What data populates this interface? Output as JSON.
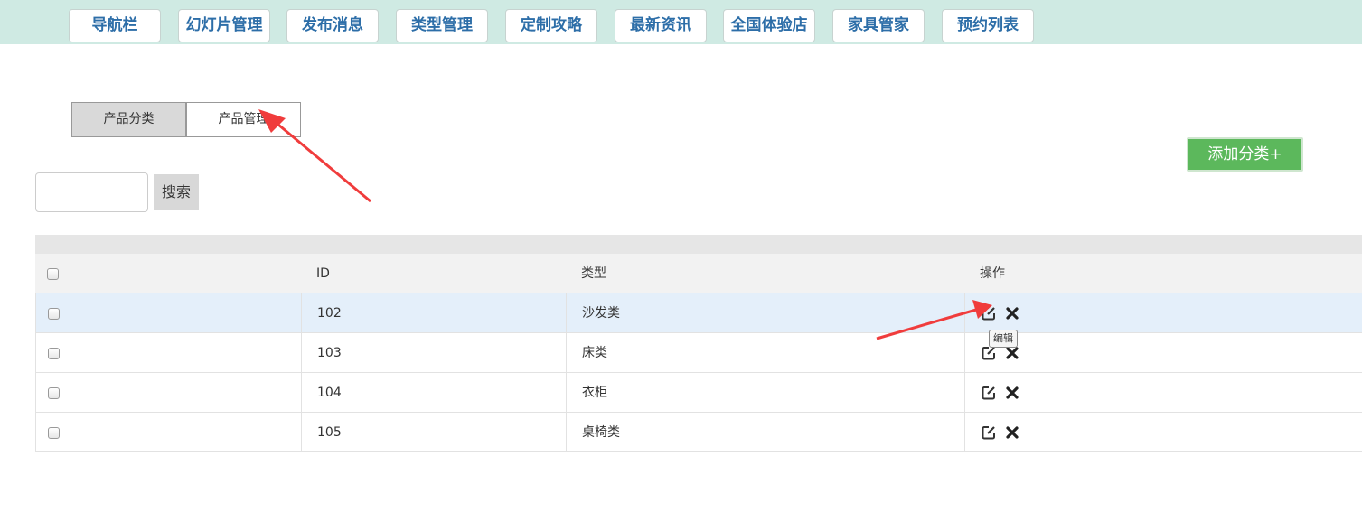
{
  "nav": {
    "items": [
      {
        "label": "导航栏"
      },
      {
        "label": "幻灯片管理"
      },
      {
        "label": "发布消息"
      },
      {
        "label": "类型管理"
      },
      {
        "label": "定制攻略"
      },
      {
        "label": "最新资讯"
      },
      {
        "label": "全国体验店"
      },
      {
        "label": "家具管家"
      },
      {
        "label": "预约列表"
      }
    ]
  },
  "tabs": [
    {
      "label": "产品分类",
      "active": true
    },
    {
      "label": "产品管理",
      "active": false
    }
  ],
  "actions": {
    "add_label": "添加分类+"
  },
  "search": {
    "value": "",
    "button_label": "搜索"
  },
  "table": {
    "columns": [
      "",
      "ID",
      "类型",
      "操作"
    ],
    "rows": [
      {
        "id": "102",
        "type": "沙发类"
      },
      {
        "id": "103",
        "type": "床类"
      },
      {
        "id": "104",
        "type": "衣柜"
      },
      {
        "id": "105",
        "type": "桌椅类"
      }
    ]
  },
  "tooltip": {
    "text": "编辑"
  },
  "colors": {
    "accent_green": "#5cb85c",
    "nav_bg": "#cfeae3",
    "nav_text": "#2d6ea8",
    "annotation_red": "#f03c3c"
  }
}
